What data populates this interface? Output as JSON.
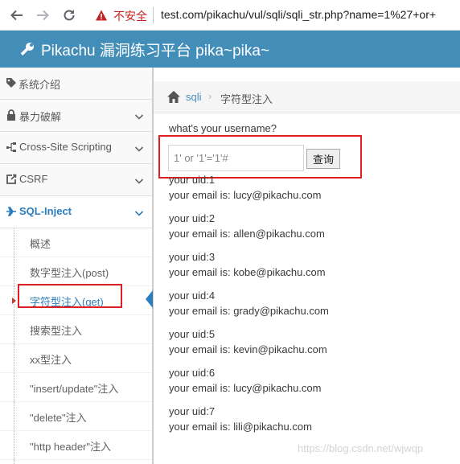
{
  "browser": {
    "insecure_label": "不安全",
    "url": "test.com/pikachu/vul/sqli/sqli_str.php?name=1%27+or+"
  },
  "header": {
    "title": "Pikachu 漏洞练习平台 pika~pika~"
  },
  "sidebar": {
    "menus": [
      {
        "label": "系统介绍",
        "icon": "tag-icon",
        "chevron": false
      },
      {
        "label": "暴力破解",
        "icon": "lock-icon",
        "chevron": true
      },
      {
        "label": "Cross-Site Scripting",
        "icon": "network-icon",
        "chevron": true
      },
      {
        "label": "CSRF",
        "icon": "external-link-icon",
        "chevron": true
      },
      {
        "label": "SQL-Inject",
        "icon": "plane-icon",
        "chevron": true,
        "active": true
      }
    ],
    "sub_items": [
      {
        "label": "概述"
      },
      {
        "label": "数字型注入(post)"
      },
      {
        "label": "字符型注入(get)",
        "current": true
      },
      {
        "label": "搜索型注入"
      },
      {
        "label": "xx型注入"
      },
      {
        "label": "\"insert/update\"注入"
      },
      {
        "label": "\"delete\"注入"
      },
      {
        "label": "\"http header\"注入"
      }
    ]
  },
  "breadcrumb": {
    "link": "sqli",
    "separator": "›",
    "current": "字符型注入"
  },
  "form": {
    "question": "what's your username?",
    "input_value": "1' or '1'='1'#",
    "button_label": "查询"
  },
  "results": [
    {
      "uid": "your uid:1",
      "email": "your email is: lucy@pikachu.com"
    },
    {
      "uid": "your uid:2",
      "email": "your email is: allen@pikachu.com"
    },
    {
      "uid": "your uid:3",
      "email": "your email is: kobe@pikachu.com"
    },
    {
      "uid": "your uid:4",
      "email": "your email is: grady@pikachu.com"
    },
    {
      "uid": "your uid:5",
      "email": "your email is: kevin@pikachu.com"
    },
    {
      "uid": "your uid:6",
      "email": "your email is: lucy@pikachu.com"
    },
    {
      "uid": "your uid:7",
      "email": "your email is: lili@pikachu.com"
    }
  ],
  "watermark": "https://blog.csdn.net/wjwqp",
  "colors": {
    "header_bg": "#438eb9",
    "accent": "#2b7dbc",
    "highlight": "#e02020",
    "insecure": "#c5221f"
  }
}
